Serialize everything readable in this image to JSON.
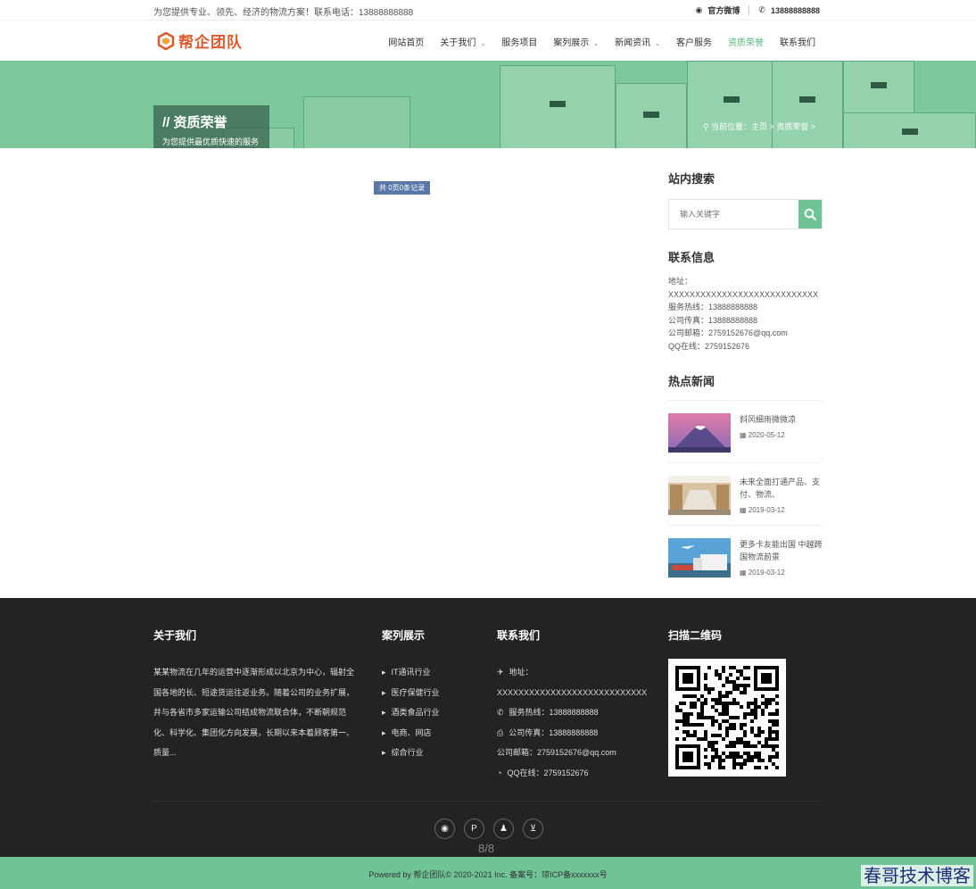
{
  "topbar": {
    "slogan": "为您提供专业、领先、经济的物流方案！联系电话：13888888888",
    "weibo_label": "官方微博",
    "phone": "13888888888"
  },
  "header": {
    "logo_text": "帮企团队",
    "nav": [
      {
        "label": "网站首页"
      },
      {
        "label": "关于我们"
      },
      {
        "label": "服务项目"
      },
      {
        "label": "案列展示"
      },
      {
        "label": "新闻资讯"
      },
      {
        "label": "客户服务"
      },
      {
        "label": "资质荣誉"
      },
      {
        "label": "联系我们"
      }
    ]
  },
  "banner": {
    "title": "// 资质荣誉",
    "subtitle": "为您提供最优质快速的服务",
    "crumb": "当前位置：主页 > 资质荣誉 >"
  },
  "main": {
    "pager": "共 0页0条记录"
  },
  "sidebar": {
    "search_title": "站内搜索",
    "search_placeholder": "输入关键字",
    "contact_title": "联系信息",
    "contact_lines": [
      "地址：",
      "XXXXXXXXXXXXXXXXXXXXXXXXXXXX",
      "服务热线：13888888888",
      "公司传真：13888888888",
      "公司邮箱：2759152676@qq.com",
      "QQ在线：2759152676"
    ],
    "news_title": "热点新闻",
    "news": [
      {
        "title": "斜风细雨微微凉",
        "date": "2020-05-12"
      },
      {
        "title": "未来全面打通产品、支付、物流、",
        "date": "2019-03-12"
      },
      {
        "title": "更多卡友能出国 中越跨国物流前景",
        "date": "2019-03-12"
      }
    ]
  },
  "footer": {
    "about_title": "关于我们",
    "about_text": "某某物流在几年的运营中逐渐形成以北京为中心，辐射全国各地的长、短途货运往返业务。随着公司的业务扩展，并与各省市多家运输公司结成物流联合体，不断朝规范化、科学化、集团化方向发展，长期以来本着顾客第一、质量...",
    "cases_title": "案列展示",
    "cases": [
      "IT通讯行业",
      "医疗保健行业",
      "酒类食品行业",
      "电商、网店",
      "综合行业"
    ],
    "contact_title": "联系我们",
    "contact": [
      "地址：",
      "XXXXXXXXXXXXXXXXXXXXXXXXXXXX",
      "服务热线：13888888888",
      "公司传真：13888888888",
      "公司邮箱：2759152676@qq.com",
      "QQ在线：2759152676"
    ],
    "qr_title": "扫描二维码",
    "page_indicator": "8/8",
    "copyright": "Powered by 帮企团队© 2020-2021 Inc. 备案号：琼ICP备xxxxxxx号"
  },
  "watermark": "春哥技术博客",
  "colors": {
    "accent": "#6fc397",
    "footer_bg": "#232323",
    "logo": "#e0582c"
  }
}
